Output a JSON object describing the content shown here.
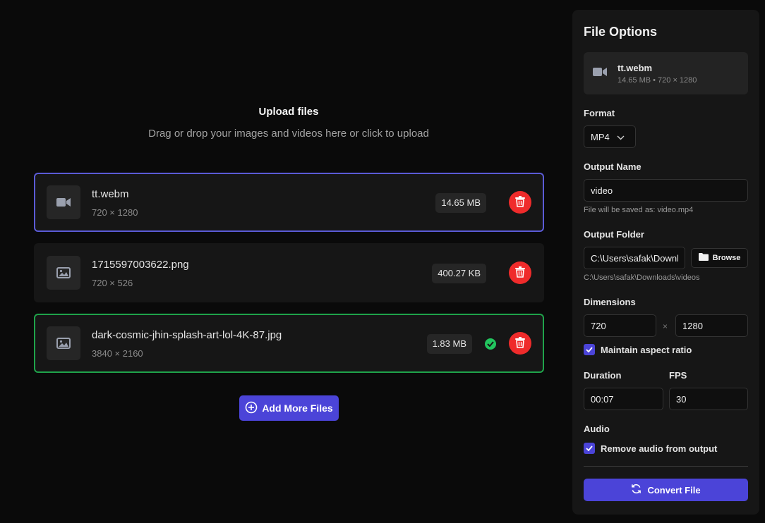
{
  "upload": {
    "title": "Upload files",
    "subtitle": "Drag or drop your images and videos here or click to upload"
  },
  "files": [
    {
      "name": "tt.webm",
      "dims": "720 × 1280",
      "size": "14.65 MB",
      "icon": "video-icon",
      "state": "selected"
    },
    {
      "name": "1715597003622.png",
      "dims": "720 × 526",
      "size": "400.27 KB",
      "icon": "image-icon",
      "state": "idle"
    },
    {
      "name": "dark-cosmic-jhin-splash-art-lol-4K-87.jpg",
      "dims": "3840 × 2160",
      "size": "1.83 MB",
      "icon": "image-icon",
      "state": "done"
    }
  ],
  "add_button_label": "Add More Files",
  "panel": {
    "title": "File Options",
    "current_file": {
      "name": "tt.webm",
      "meta": "14.65 MB • 720 × 1280"
    },
    "format_label": "Format",
    "format_value": "MP4",
    "output_name_label": "Output Name",
    "output_name_value": "video",
    "output_name_hint": "File will be saved as: video.mp4",
    "output_folder_label": "Output Folder",
    "output_folder_value": "C:\\Users\\safak\\Downloads\\videos",
    "output_folder_hint": "C:\\Users\\safak\\Downloads\\videos",
    "browse_label": "Browse",
    "dimensions_label": "Dimensions",
    "width_value": "720",
    "height_value": "1280",
    "dims_separator": "×",
    "aspect_label": "Maintain aspect ratio",
    "duration_label": "Duration",
    "duration_value": "00:07",
    "fps_label": "FPS",
    "fps_value": "30",
    "audio_label": "Audio",
    "remove_audio_label": "Remove audio from output",
    "convert_label": "Convert File"
  },
  "colors": {
    "accent": "#4b44d8",
    "selected_border": "#5b5bd6",
    "done_border": "#1fa34a",
    "delete": "#ef2b2b",
    "success": "#22c55e"
  }
}
